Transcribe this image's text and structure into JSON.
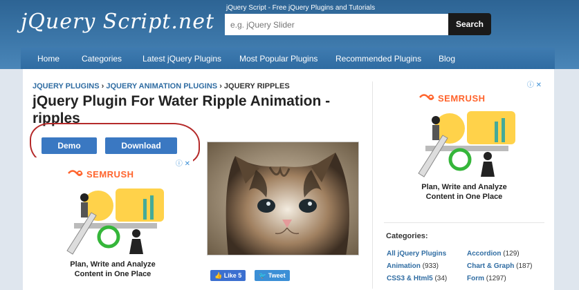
{
  "header": {
    "logo": "jQuery Script.net",
    "tagline": "jQuery Script - Free jQuery Plugins and Tutorials",
    "search_placeholder": "e.g. jQuery Slider",
    "search_button": "Search"
  },
  "nav": {
    "items": [
      "Home",
      "Categories",
      "Latest jQuery Plugins",
      "Most Popular Plugins",
      "Recommended Plugins",
      "Blog"
    ]
  },
  "breadcrumb": {
    "item1": "JQUERY PLUGINS",
    "item2": "JQUERY ANIMATION PLUGINS",
    "current": "JQUERY RIPPLES",
    "separator": "›"
  },
  "title": "jQuery Plugin For Water Ripple Animation - ripples",
  "buttons": {
    "demo": "Demo",
    "download": "Download"
  },
  "ad": {
    "brand": "SEMRUSH",
    "line1": "Plan, Write and Analyze",
    "line2": "Content in One Place"
  },
  "social": {
    "like": "Like 5",
    "tweet": "Tweet"
  },
  "categories": {
    "title": "Categories:",
    "left": [
      {
        "label": "All jQuery Plugins",
        "count": ""
      },
      {
        "label": "Animation",
        "count": "(933)"
      },
      {
        "label": "CSS3 & Html5",
        "count": "(34)"
      }
    ],
    "right": [
      {
        "label": "Accordion",
        "count": "(129)"
      },
      {
        "label": "Chart & Graph",
        "count": "(187)"
      },
      {
        "label": "Form",
        "count": "(1297)"
      }
    ]
  },
  "colors": {
    "accent": "#3a78c2",
    "header": "#2d6494",
    "semrush": "#ff642d",
    "annotation": "#b52a2a"
  }
}
